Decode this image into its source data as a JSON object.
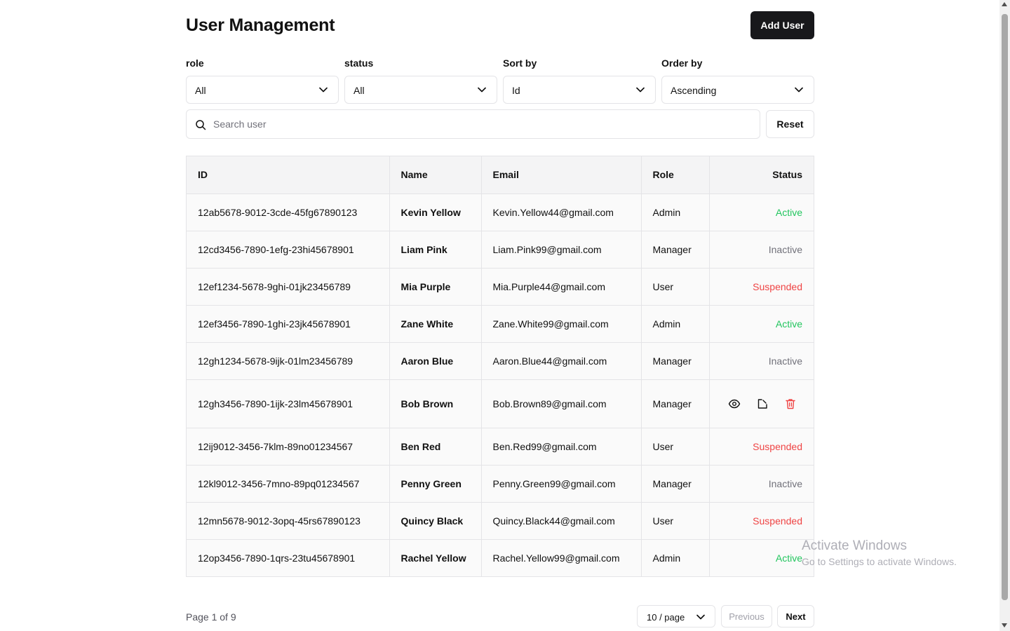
{
  "page": {
    "title": "User Management",
    "add_user_label": "Add User"
  },
  "filters": [
    {
      "label": "role",
      "value": "All"
    },
    {
      "label": "status",
      "value": "All"
    },
    {
      "label": "Sort by",
      "value": "Id"
    },
    {
      "label": "Order by",
      "value": "Ascending"
    }
  ],
  "search": {
    "placeholder": "Search user",
    "value": "",
    "reset_label": "Reset"
  },
  "table": {
    "columns": [
      "ID",
      "Name",
      "Email",
      "Role",
      "Status"
    ],
    "rows": [
      {
        "id": "12ab5678-9012-3cde-45fg67890123",
        "name": "Kevin Yellow",
        "email": "Kevin.Yellow44@gmail.com",
        "role": "Admin",
        "status": "Active"
      },
      {
        "id": "12cd3456-7890-1efg-23hi45678901",
        "name": "Liam Pink",
        "email": "Liam.Pink99@gmail.com",
        "role": "Manager",
        "status": "Inactive"
      },
      {
        "id": "12ef1234-5678-9ghi-01jk23456789",
        "name": "Mia Purple",
        "email": "Mia.Purple44@gmail.com",
        "role": "User",
        "status": "Suspended"
      },
      {
        "id": "12ef3456-7890-1ghi-23jk45678901",
        "name": "Zane White",
        "email": "Zane.White99@gmail.com",
        "role": "Admin",
        "status": "Active"
      },
      {
        "id": "12gh1234-5678-9ijk-01lm23456789",
        "name": "Aaron Blue",
        "email": "Aaron.Blue44@gmail.com",
        "role": "Manager",
        "status": "Inactive"
      },
      {
        "id": "12gh3456-7890-1ijk-23lm45678901",
        "name": "Bob Brown",
        "email": "Bob.Brown89@gmail.com",
        "role": "Manager",
        "status": ""
      },
      {
        "id": "12ij9012-3456-7klm-89no01234567",
        "name": "Ben Red",
        "email": "Ben.Red99@gmail.com",
        "role": "User",
        "status": "Suspended"
      },
      {
        "id": "12kl9012-3456-7mno-89pq01234567",
        "name": "Penny Green",
        "email": "Penny.Green99@gmail.com",
        "role": "Manager",
        "status": "Inactive"
      },
      {
        "id": "12mn5678-9012-3opq-45rs67890123",
        "name": "Quincy Black",
        "email": "Quincy.Black44@gmail.com",
        "role": "User",
        "status": "Suspended"
      },
      {
        "id": "12op3456-7890-1qrs-23tu45678901",
        "name": "Rachel Yellow",
        "email": "Rachel.Yellow99@gmail.com",
        "role": "Admin",
        "status": "Active"
      }
    ],
    "hovered_row_actions": [
      "eye-icon",
      "edit-icon",
      "trash-icon"
    ]
  },
  "pagination": {
    "info": "Page 1 of 9",
    "page_size": "10 / page",
    "previous_label": "Previous",
    "next_label": "Next"
  },
  "watermark": {
    "title": "Activate Windows",
    "subtitle": "Go to Settings to activate Windows."
  },
  "colors": {
    "primary": "#18181b",
    "active": "#22c55e",
    "inactive": "#71717a",
    "suspended": "#ef4444",
    "border": "#e4e4e7",
    "header_bg": "#f4f4f5"
  }
}
